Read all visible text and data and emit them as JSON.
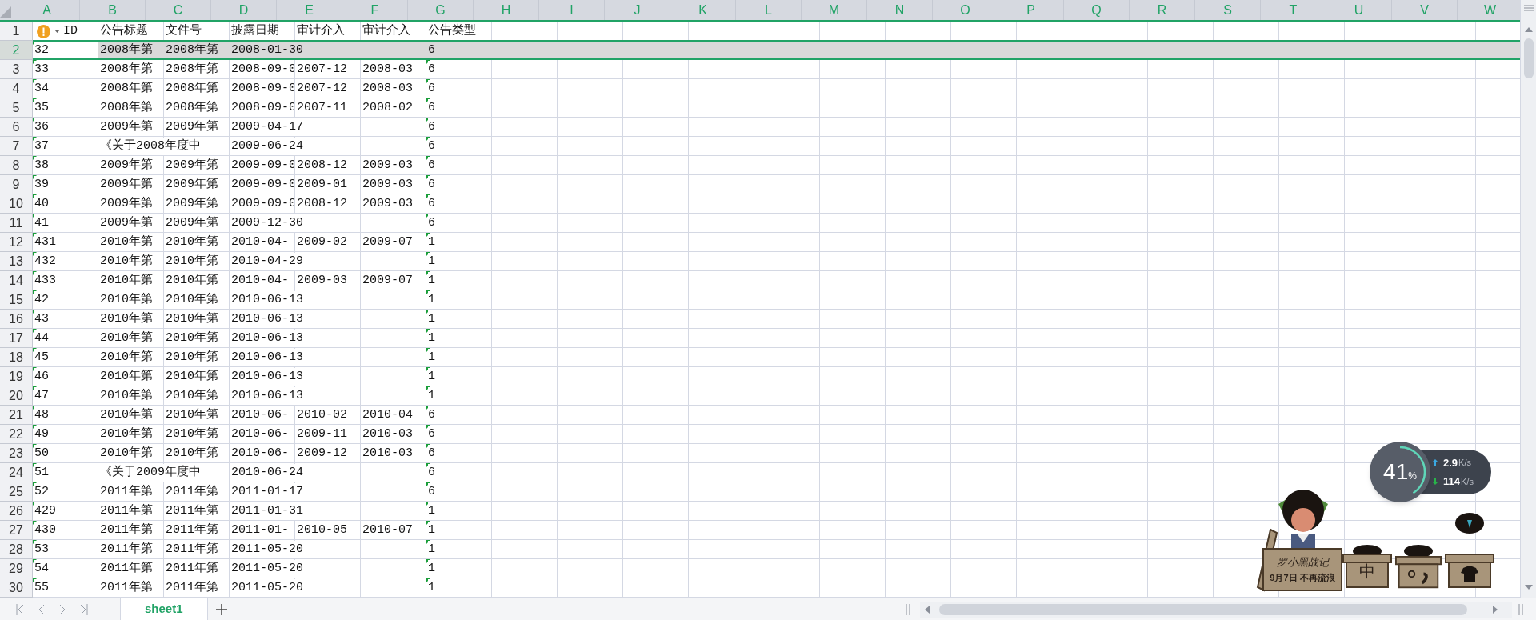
{
  "table": {
    "warning_icon": true,
    "columns": [
      {
        "label": "A",
        "highlighted": true
      },
      {
        "label": "B",
        "highlighted": true
      },
      {
        "label": "C",
        "highlighted": true
      },
      {
        "label": "D",
        "highlighted": true
      },
      {
        "label": "E",
        "highlighted": true
      },
      {
        "label": "F",
        "highlighted": true
      },
      {
        "label": "G",
        "highlighted": true
      },
      {
        "label": "H",
        "highlighted": true
      },
      {
        "label": "I",
        "highlighted": true
      },
      {
        "label": "J",
        "highlighted": true
      },
      {
        "label": "K",
        "highlighted": true
      },
      {
        "label": "L",
        "highlighted": true
      },
      {
        "label": "M",
        "highlighted": true
      },
      {
        "label": "N",
        "highlighted": true
      },
      {
        "label": "O",
        "highlighted": true
      },
      {
        "label": "P",
        "highlighted": true
      },
      {
        "label": "Q",
        "highlighted": true
      },
      {
        "label": "R",
        "highlighted": true
      },
      {
        "label": "S",
        "highlighted": true
      },
      {
        "label": "T",
        "highlighted": true
      },
      {
        "label": "U",
        "highlighted": true
      },
      {
        "label": "V",
        "highlighted": true
      },
      {
        "label": "W",
        "highlighted": true
      }
    ],
    "rows": [
      {
        "number": "1",
        "selected": false,
        "flag_a": false,
        "flag_g": false,
        "cells": [
          "ID",
          "公告标题",
          "文件号",
          "披露日期",
          "审计介入",
          "审计介入",
          "公告类型"
        ]
      },
      {
        "number": "2",
        "selected": true,
        "flag_a": true,
        "flag_g": false,
        "cells": [
          "32",
          "2008年第",
          "2008年第",
          "2008-01-30",
          null,
          null,
          "6"
        ]
      },
      {
        "number": "3",
        "selected": false,
        "flag_a": true,
        "flag_g": true,
        "cells": [
          "33",
          "2008年第",
          "2008年第",
          "2008-09-0",
          "2007-12",
          "2008-03",
          "6"
        ]
      },
      {
        "number": "4",
        "selected": false,
        "flag_a": true,
        "flag_g": true,
        "cells": [
          "34",
          "2008年第",
          "2008年第",
          "2008-09-0",
          "2007-12",
          "2008-03",
          "6"
        ]
      },
      {
        "number": "5",
        "selected": false,
        "flag_a": true,
        "flag_g": true,
        "cells": [
          "35",
          "2008年第",
          "2008年第",
          "2008-09-0",
          "2007-11",
          "2008-02",
          "6"
        ]
      },
      {
        "number": "6",
        "selected": false,
        "flag_a": true,
        "flag_g": true,
        "cells": [
          "36",
          "2009年第",
          "2009年第",
          "2009-04-17",
          null,
          null,
          "6"
        ]
      },
      {
        "number": "7",
        "selected": false,
        "flag_a": true,
        "flag_g": true,
        "cells": [
          "37",
          "《关于2008年度中",
          null,
          "2009-06-24",
          null,
          null,
          "6"
        ]
      },
      {
        "number": "8",
        "selected": false,
        "flag_a": true,
        "flag_g": true,
        "cells": [
          "38",
          "2009年第",
          "2009年第",
          "2009-09-0",
          "2008-12",
          "2009-03",
          "6"
        ]
      },
      {
        "number": "9",
        "selected": false,
        "flag_a": true,
        "flag_g": true,
        "cells": [
          "39",
          "2009年第",
          "2009年第",
          "2009-09-0",
          "2009-01",
          "2009-03",
          "6"
        ]
      },
      {
        "number": "10",
        "selected": false,
        "flag_a": true,
        "flag_g": true,
        "cells": [
          "40",
          "2009年第",
          "2009年第",
          "2009-09-0",
          "2008-12",
          "2009-03",
          "6"
        ]
      },
      {
        "number": "11",
        "selected": false,
        "flag_a": true,
        "flag_g": true,
        "cells": [
          "41",
          "2009年第",
          "2009年第",
          "2009-12-30",
          null,
          null,
          "6"
        ]
      },
      {
        "number": "12",
        "selected": false,
        "flag_a": true,
        "flag_g": true,
        "cells": [
          "431",
          "2010年第",
          "2010年第",
          "2010-04-",
          "2009-02",
          "2009-07",
          "1"
        ]
      },
      {
        "number": "13",
        "selected": false,
        "flag_a": true,
        "flag_g": true,
        "cells": [
          "432",
          "2010年第",
          "2010年第",
          "2010-04-29",
          null,
          null,
          "1"
        ]
      },
      {
        "number": "14",
        "selected": false,
        "flag_a": true,
        "flag_g": true,
        "cells": [
          "433",
          "2010年第",
          "2010年第",
          "2010-04-",
          "2009-03",
          "2009-07",
          "1"
        ]
      },
      {
        "number": "15",
        "selected": false,
        "flag_a": true,
        "flag_g": true,
        "cells": [
          "42",
          "2010年第",
          "2010年第",
          "2010-06-13",
          null,
          null,
          "1"
        ]
      },
      {
        "number": "16",
        "selected": false,
        "flag_a": true,
        "flag_g": true,
        "cells": [
          "43",
          "2010年第",
          "2010年第",
          "2010-06-13",
          null,
          null,
          "1"
        ]
      },
      {
        "number": "17",
        "selected": false,
        "flag_a": true,
        "flag_g": true,
        "cells": [
          "44",
          "2010年第",
          "2010年第",
          "2010-06-13",
          null,
          null,
          "1"
        ]
      },
      {
        "number": "18",
        "selected": false,
        "flag_a": true,
        "flag_g": true,
        "cells": [
          "45",
          "2010年第",
          "2010年第",
          "2010-06-13",
          null,
          null,
          "1"
        ]
      },
      {
        "number": "19",
        "selected": false,
        "flag_a": true,
        "flag_g": true,
        "cells": [
          "46",
          "2010年第",
          "2010年第",
          "2010-06-13",
          null,
          null,
          "1"
        ]
      },
      {
        "number": "20",
        "selected": false,
        "flag_a": true,
        "flag_g": true,
        "cells": [
          "47",
          "2010年第",
          "2010年第",
          "2010-06-13",
          null,
          null,
          "1"
        ]
      },
      {
        "number": "21",
        "selected": false,
        "flag_a": true,
        "flag_g": true,
        "cells": [
          "48",
          "2010年第",
          "2010年第",
          "2010-06-",
          "2010-02",
          "2010-04",
          "6"
        ]
      },
      {
        "number": "22",
        "selected": false,
        "flag_a": true,
        "flag_g": true,
        "cells": [
          "49",
          "2010年第",
          "2010年第",
          "2010-06-",
          "2009-11",
          "2010-03",
          "6"
        ]
      },
      {
        "number": "23",
        "selected": false,
        "flag_a": true,
        "flag_g": true,
        "cells": [
          "50",
          "2010年第",
          "2010年第",
          "2010-06-",
          "2009-12",
          "2010-03",
          "6"
        ]
      },
      {
        "number": "24",
        "selected": false,
        "flag_a": true,
        "flag_g": true,
        "cells": [
          "51",
          "《关于2009年度中",
          null,
          "2010-06-24",
          null,
          null,
          "6"
        ]
      },
      {
        "number": "25",
        "selected": false,
        "flag_a": true,
        "flag_g": true,
        "cells": [
          "52",
          "2011年第",
          "2011年第",
          "2011-01-17",
          null,
          null,
          "6"
        ]
      },
      {
        "number": "26",
        "selected": false,
        "flag_a": true,
        "flag_g": true,
        "cells": [
          "429",
          "2011年第",
          "2011年第",
          "2011-01-31",
          null,
          null,
          "1"
        ]
      },
      {
        "number": "27",
        "selected": false,
        "flag_a": true,
        "flag_g": true,
        "cells": [
          "430",
          "2011年第",
          "2011年第",
          "2011-01-",
          "2010-05",
          "2010-07",
          "1"
        ]
      },
      {
        "number": "28",
        "selected": false,
        "flag_a": true,
        "flag_g": true,
        "cells": [
          "53",
          "2011年第",
          "2011年第",
          "2011-05-20",
          null,
          null,
          "1"
        ]
      },
      {
        "number": "29",
        "selected": false,
        "flag_a": true,
        "flag_g": true,
        "cells": [
          "54",
          "2011年第",
          "2011年第",
          "2011-05-20",
          null,
          null,
          "1"
        ]
      },
      {
        "number": "30",
        "selected": false,
        "flag_a": true,
        "flag_g": true,
        "cells": [
          "55",
          "2011年第",
          "2011年第",
          "2011-05-20",
          null,
          null,
          "1"
        ]
      }
    ]
  },
  "sheet_tabs": [
    {
      "label": "sheet1",
      "selected": true
    }
  ],
  "network_widget": {
    "cpu": "41",
    "cpu_unit": "%",
    "level": 0.41,
    "upload": "2.9",
    "upload_unit": "K/s",
    "download": "114",
    "download_unit": "K/s"
  },
  "mascot": {
    "title": "罗小黑战记",
    "caption": "9月7日 不再流浪",
    "box_label": "中"
  }
}
